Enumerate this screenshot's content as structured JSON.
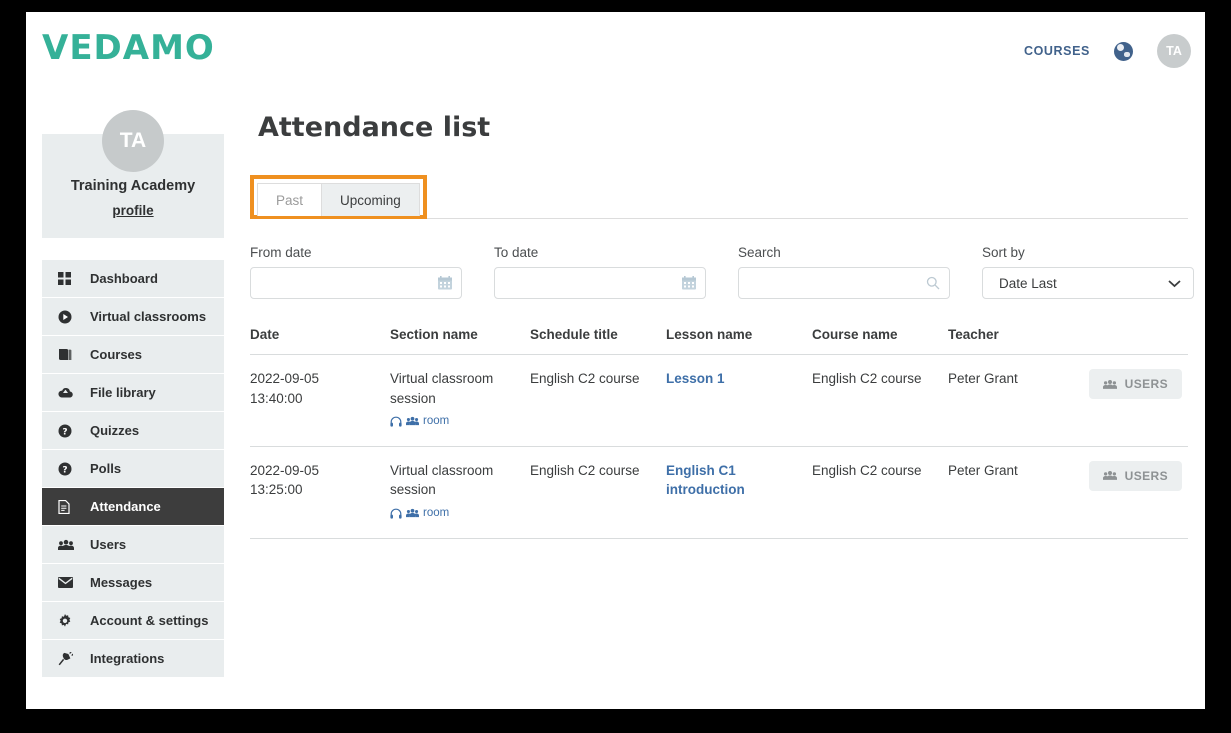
{
  "header": {
    "logo": "VEDAMO",
    "courses_label": "COURSES",
    "globe_icon": "globe-icon",
    "avatar_initials": "TA"
  },
  "sidebar": {
    "profile": {
      "avatar_initials": "TA",
      "name": "Training Academy",
      "profile_link": "profile"
    },
    "items": [
      {
        "label": "Dashboard",
        "icon": "grid-icon",
        "active": false
      },
      {
        "label": "Virtual classrooms",
        "icon": "play-circle-icon",
        "active": false
      },
      {
        "label": "Courses",
        "icon": "book-icon",
        "active": false
      },
      {
        "label": "File library",
        "icon": "cloud-upload-icon",
        "active": false
      },
      {
        "label": "Quizzes",
        "icon": "question-icon",
        "active": false
      },
      {
        "label": "Polls",
        "icon": "question-icon",
        "active": false
      },
      {
        "label": "Attendance",
        "icon": "document-icon",
        "active": true
      },
      {
        "label": "Users",
        "icon": "users-icon",
        "active": false
      },
      {
        "label": "Messages",
        "icon": "envelope-icon",
        "active": false
      },
      {
        "label": "Account & settings",
        "icon": "gear-icon",
        "active": false
      },
      {
        "label": "Integrations",
        "icon": "plug-icon",
        "active": false
      }
    ]
  },
  "main": {
    "title": "Attendance list",
    "tabs": [
      {
        "label": "Past",
        "active": true
      },
      {
        "label": "Upcoming",
        "active": false
      }
    ],
    "filters": {
      "from_date": {
        "label": "From date",
        "value": "",
        "placeholder": "",
        "icon": "calendar-icon"
      },
      "to_date": {
        "label": "To date",
        "value": "",
        "placeholder": "",
        "icon": "calendar-icon"
      },
      "search": {
        "label": "Search",
        "value": "",
        "placeholder": "",
        "icon": "search-icon"
      },
      "sort_by": {
        "label": "Sort by",
        "value": "Date Last",
        "icon": "chevron-down-icon",
        "options": [
          "Date Last"
        ]
      }
    },
    "table": {
      "columns": [
        "Date",
        "Section name",
        "Schedule title",
        "Lesson name",
        "Course name",
        "Teacher",
        ""
      ],
      "rows": [
        {
          "date": "2022-09-05\n13:40:00",
          "section_name": "Virtual classroom session",
          "room_label": "room",
          "schedule_title": "English C2 course",
          "lesson_name": "Lesson 1",
          "course_name": "English C2 course",
          "teacher": "Peter Grant",
          "action_label": "USERS"
        },
        {
          "date": "2022-09-05\n13:25:00",
          "section_name": "Virtual classroom session",
          "room_label": "room",
          "schedule_title": "English C2 course",
          "lesson_name": "English C1 introduction",
          "course_name": "English C2 course",
          "teacher": "Peter Grant",
          "action_label": "USERS"
        }
      ]
    }
  },
  "colors": {
    "brand_green": "#35b198",
    "highlight_orange": "#ef9020",
    "link_blue": "#3e6fa8",
    "active_dark": "#3d3d3d",
    "panel_gray": "#e9edee"
  }
}
